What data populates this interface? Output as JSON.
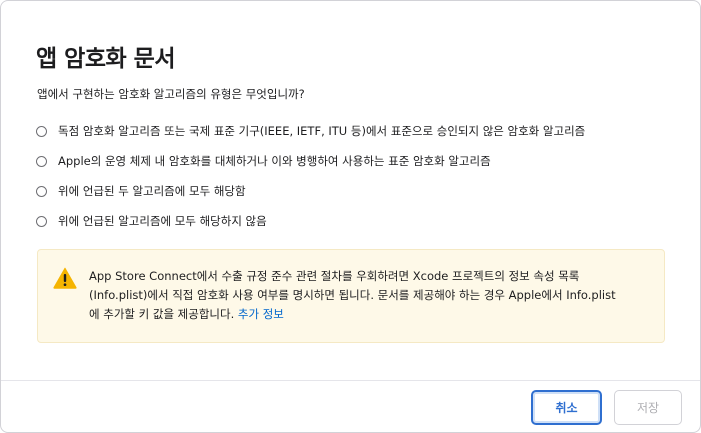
{
  "dialog": {
    "title": "앱 암호화 문서",
    "question": "앱에서 구현하는 암호화 알고리즘의 유형은 무엇입니까?",
    "options": [
      {
        "label": "독점 암호화 알고리즘 또는 국제 표준 기구(IEEE, IETF, ITU 등)에서 표준으로 승인되지 않은 암호화 알고리즘",
        "selected": false
      },
      {
        "label": "Apple의 운영 체제 내 암호화를 대체하거나 이와 병행하여 사용하는 표준 암호화 알고리즘",
        "selected": false
      },
      {
        "label": "위에 언급된 두 알고리즘에 모두 해당함",
        "selected": false
      },
      {
        "label": "위에 언급된 알고리즘에 모두 해당하지 않음",
        "selected": false
      }
    ],
    "notice": {
      "icon": "warning-icon",
      "text_line1": "App Store Connect에서 수출 규정 준수 관련 절차를 우회하려면 Xcode 프로젝트의 정보 속성 목록",
      "text_line2": "(Info.plist)에서 직접 암호화 사용 여부를 명시하면 됩니다. 문서를 제공해야 하는 경우 Apple에서 Info.plist",
      "text_line3": "에 추가할 키 값을 제공합니다.",
      "link": "추가 정보",
      "colors": {
        "background": "#fef9e8",
        "icon": "#f5b400",
        "link": "#0066cc"
      }
    },
    "buttons": {
      "cancel": "취소",
      "save": "저장"
    }
  }
}
